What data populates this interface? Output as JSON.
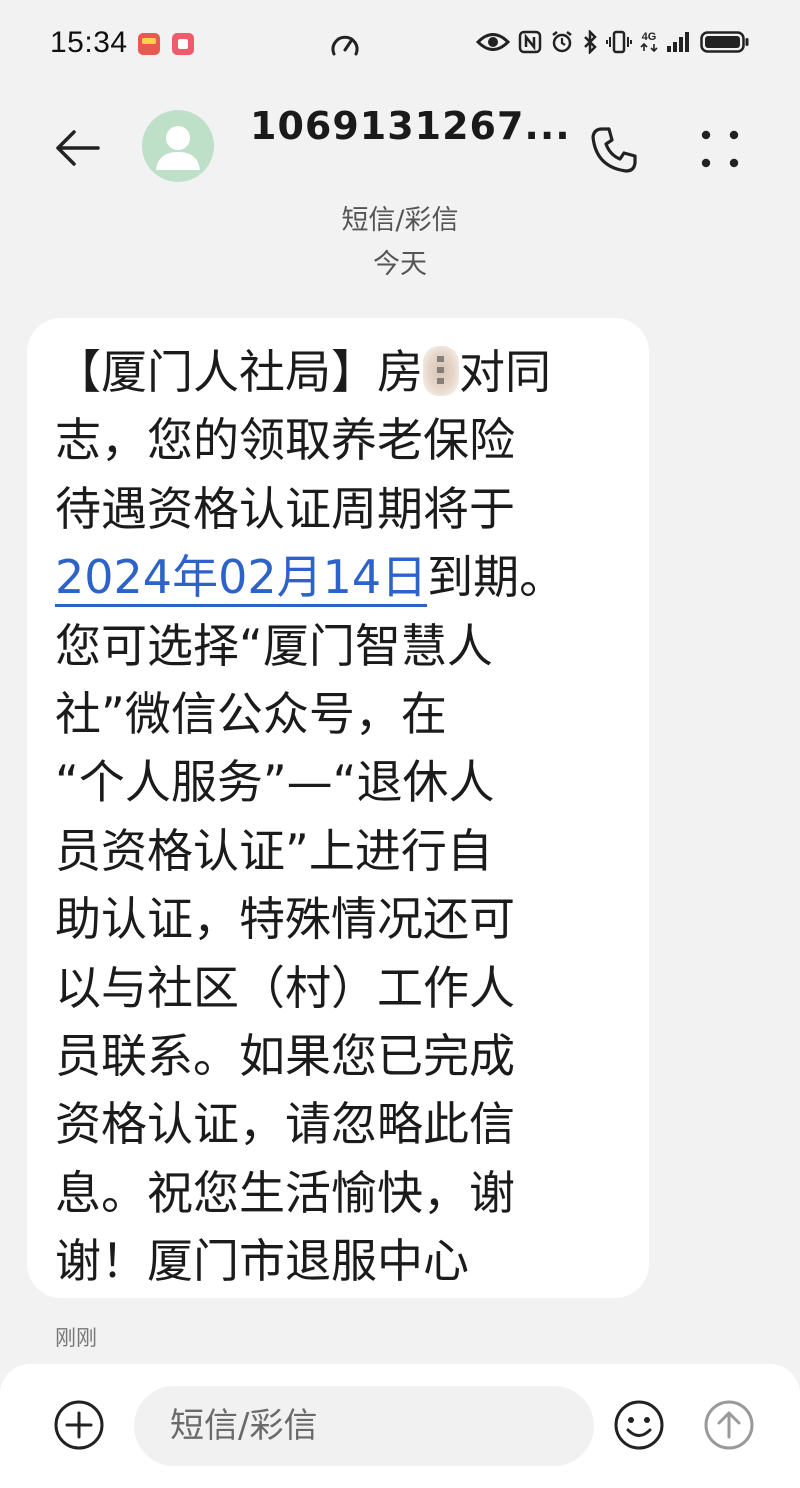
{
  "status_bar": {
    "time": "15:34",
    "network_label": "4G"
  },
  "header": {
    "contact": "1069131267...",
    "message_type": "短信/彩信",
    "date": "今天"
  },
  "message": {
    "lines": [
      {
        "pre": "【厦门人社局】房",
        "post": "对同"
      },
      "志，您的领取养老保险",
      "待遇资格认证周期将于",
      {
        "link": "2024年02月14日",
        "after": "到期。"
      },
      "您可选择“厦门智慧人",
      "社”微信公众号，在",
      "“个人服务”—“退休人",
      "员资格认证”上进行自",
      "助认证，特殊情况还可",
      "以与社区（村）工作人",
      "员联系。如果您已完成",
      "资格认证，请忽略此信",
      "息。祝您生活愉快，谢",
      "谢！厦门市退服中心"
    ],
    "time": "刚刚"
  },
  "composer": {
    "placeholder": "短信/彩信"
  },
  "colors": {
    "link": "#2d62c9",
    "avatar_bg": "#bfe0c8",
    "background": "#f2f2f2"
  },
  "icons": {
    "back": "back-arrow-icon",
    "call": "phone-icon",
    "more": "more-dots-icon",
    "add": "plus-circle-icon",
    "emoji": "smiley-icon",
    "send": "send-arrow-icon"
  }
}
